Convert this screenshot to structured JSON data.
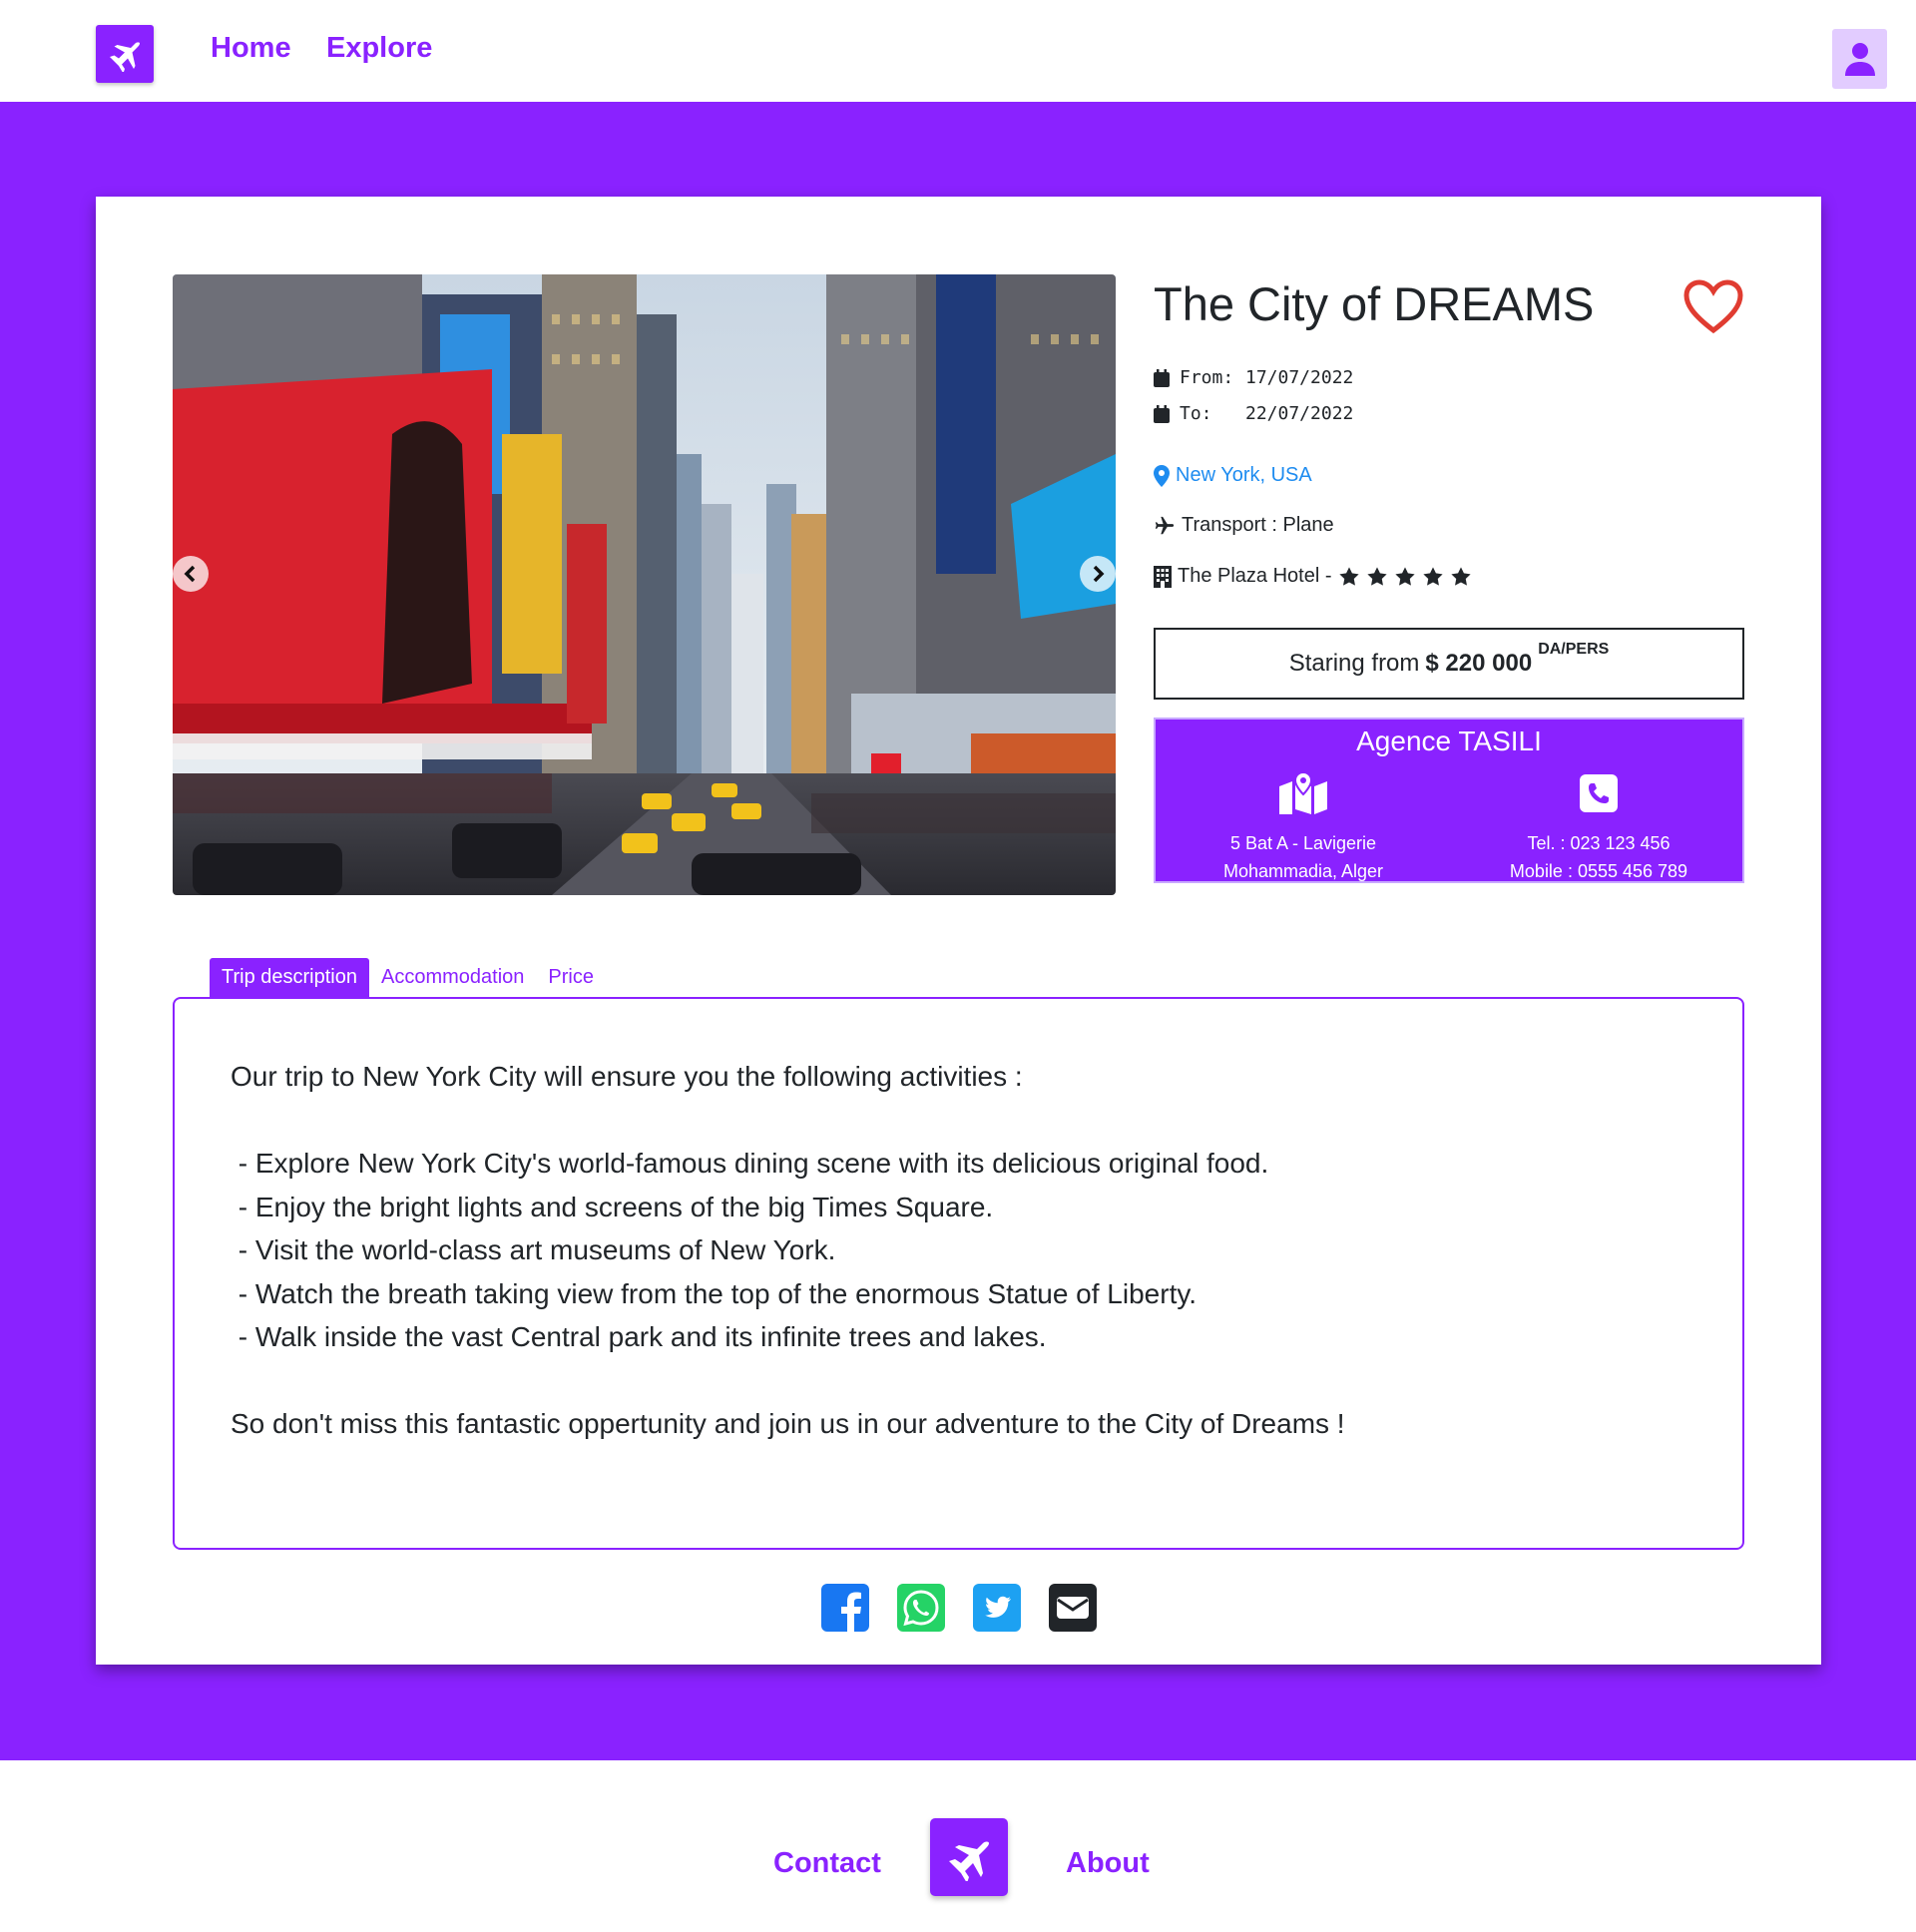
{
  "nav": {
    "logo_icon": "plane-icon",
    "links": [
      "Home",
      "Explore"
    ],
    "user_icon": "user-icon"
  },
  "trip": {
    "title": "The City of DREAMS",
    "from_label": "From:",
    "from_date": "17/07/2022",
    "to_label": "To:",
    "to_date": "22/07/2022",
    "location": "New York, USA",
    "transport": "Transport : Plane",
    "hotel": "The Plaza Hotel -",
    "hotel_stars": 5,
    "price_prefix": "Staring from",
    "price_amount": "$ 220 000",
    "price_unit": "DA/PERS"
  },
  "agency": {
    "name": "Agence TASILI",
    "address_line1": "5 Bat A - Lavigerie",
    "address_line2": "Mohammadia, Alger",
    "tel": "Tel. : 023 123 456",
    "mobile": "Mobile : 0555 456 789"
  },
  "tabs": [
    "Trip description",
    "Accommodation",
    "Price"
  ],
  "active_tab": 0,
  "description": {
    "intro": "Our trip to New York City will ensure you the following activities :",
    "items": [
      " - Explore New York City's world-famous dining scene with its delicious original food.",
      " - Enjoy the bright lights and screens of the big Times Square.",
      " - Visit the world-class art museums of New York.",
      " - Watch the breath taking view from the top of the enormous Statue of Liberty.",
      " - Walk inside the vast Central park and its infinite trees and lakes."
    ],
    "outro": "So don't miss this fantastic oppertunity and join us in our adventure to the City of Dreams !"
  },
  "share_icons": [
    "facebook-icon",
    "whatsapp-icon",
    "twitter-icon",
    "email-icon"
  ],
  "footer": {
    "links": [
      "Contact",
      "About"
    ]
  },
  "colors": {
    "primary": "#8a22ff",
    "link_blue": "#1e8cf0",
    "heart": "#e03c31",
    "facebook": "#1877f2",
    "whatsapp": "#25d366",
    "twitter": "#1da1f2"
  }
}
